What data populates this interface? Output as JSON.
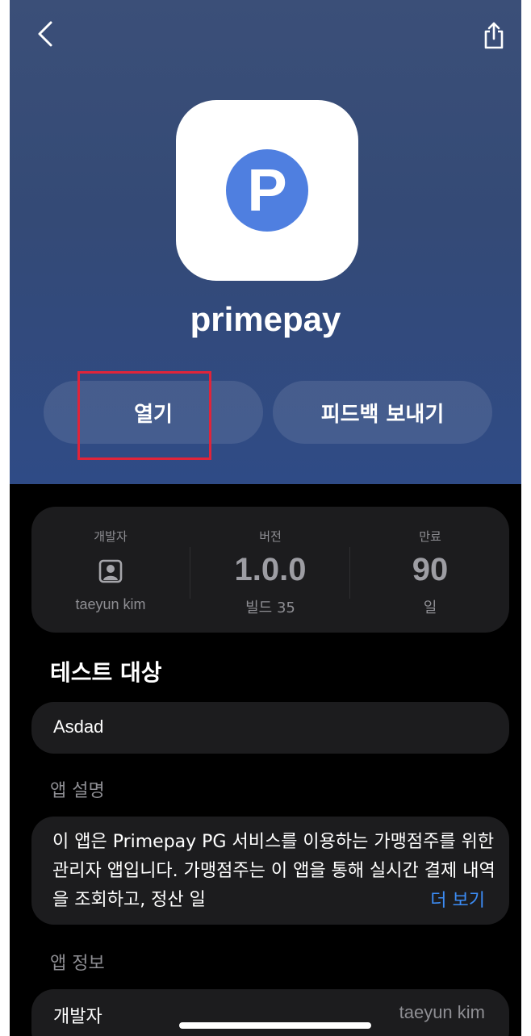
{
  "nav": {
    "back_icon": "chevron-left-icon",
    "share_icon": "share-icon"
  },
  "app": {
    "name": "primepay",
    "icon_letter": "P",
    "icon_color": "#4f7fe0"
  },
  "actions": {
    "open_label": "열기",
    "feedback_label": "피드백 보내기"
  },
  "info": {
    "developer_label": "개발자",
    "developer_name": "taeyun kim",
    "version_label": "버전",
    "version": "1.0.0",
    "build": "빌드 35",
    "expiry_label": "만료",
    "expiry_value": "90",
    "expiry_unit": "일"
  },
  "testers": {
    "title": "테스트 대상",
    "group": "Asdad"
  },
  "description": {
    "title": "앱 설명",
    "text": "이 앱은 Primepay PG 서비스를 이용하는 가맹점주를 위한 관리자 앱입니다. 가맹점주는 이 앱을 통해 실시간 결제 내역을 조회하고, 정산 일",
    "more_label": "더 보기"
  },
  "app_info": {
    "title": "앱 정보",
    "developer_key": "개발자",
    "developer_value": "taeyun kim"
  },
  "colors": {
    "highlight": "#e0243a",
    "link": "#3c8cf5",
    "hero": "#344a76"
  }
}
